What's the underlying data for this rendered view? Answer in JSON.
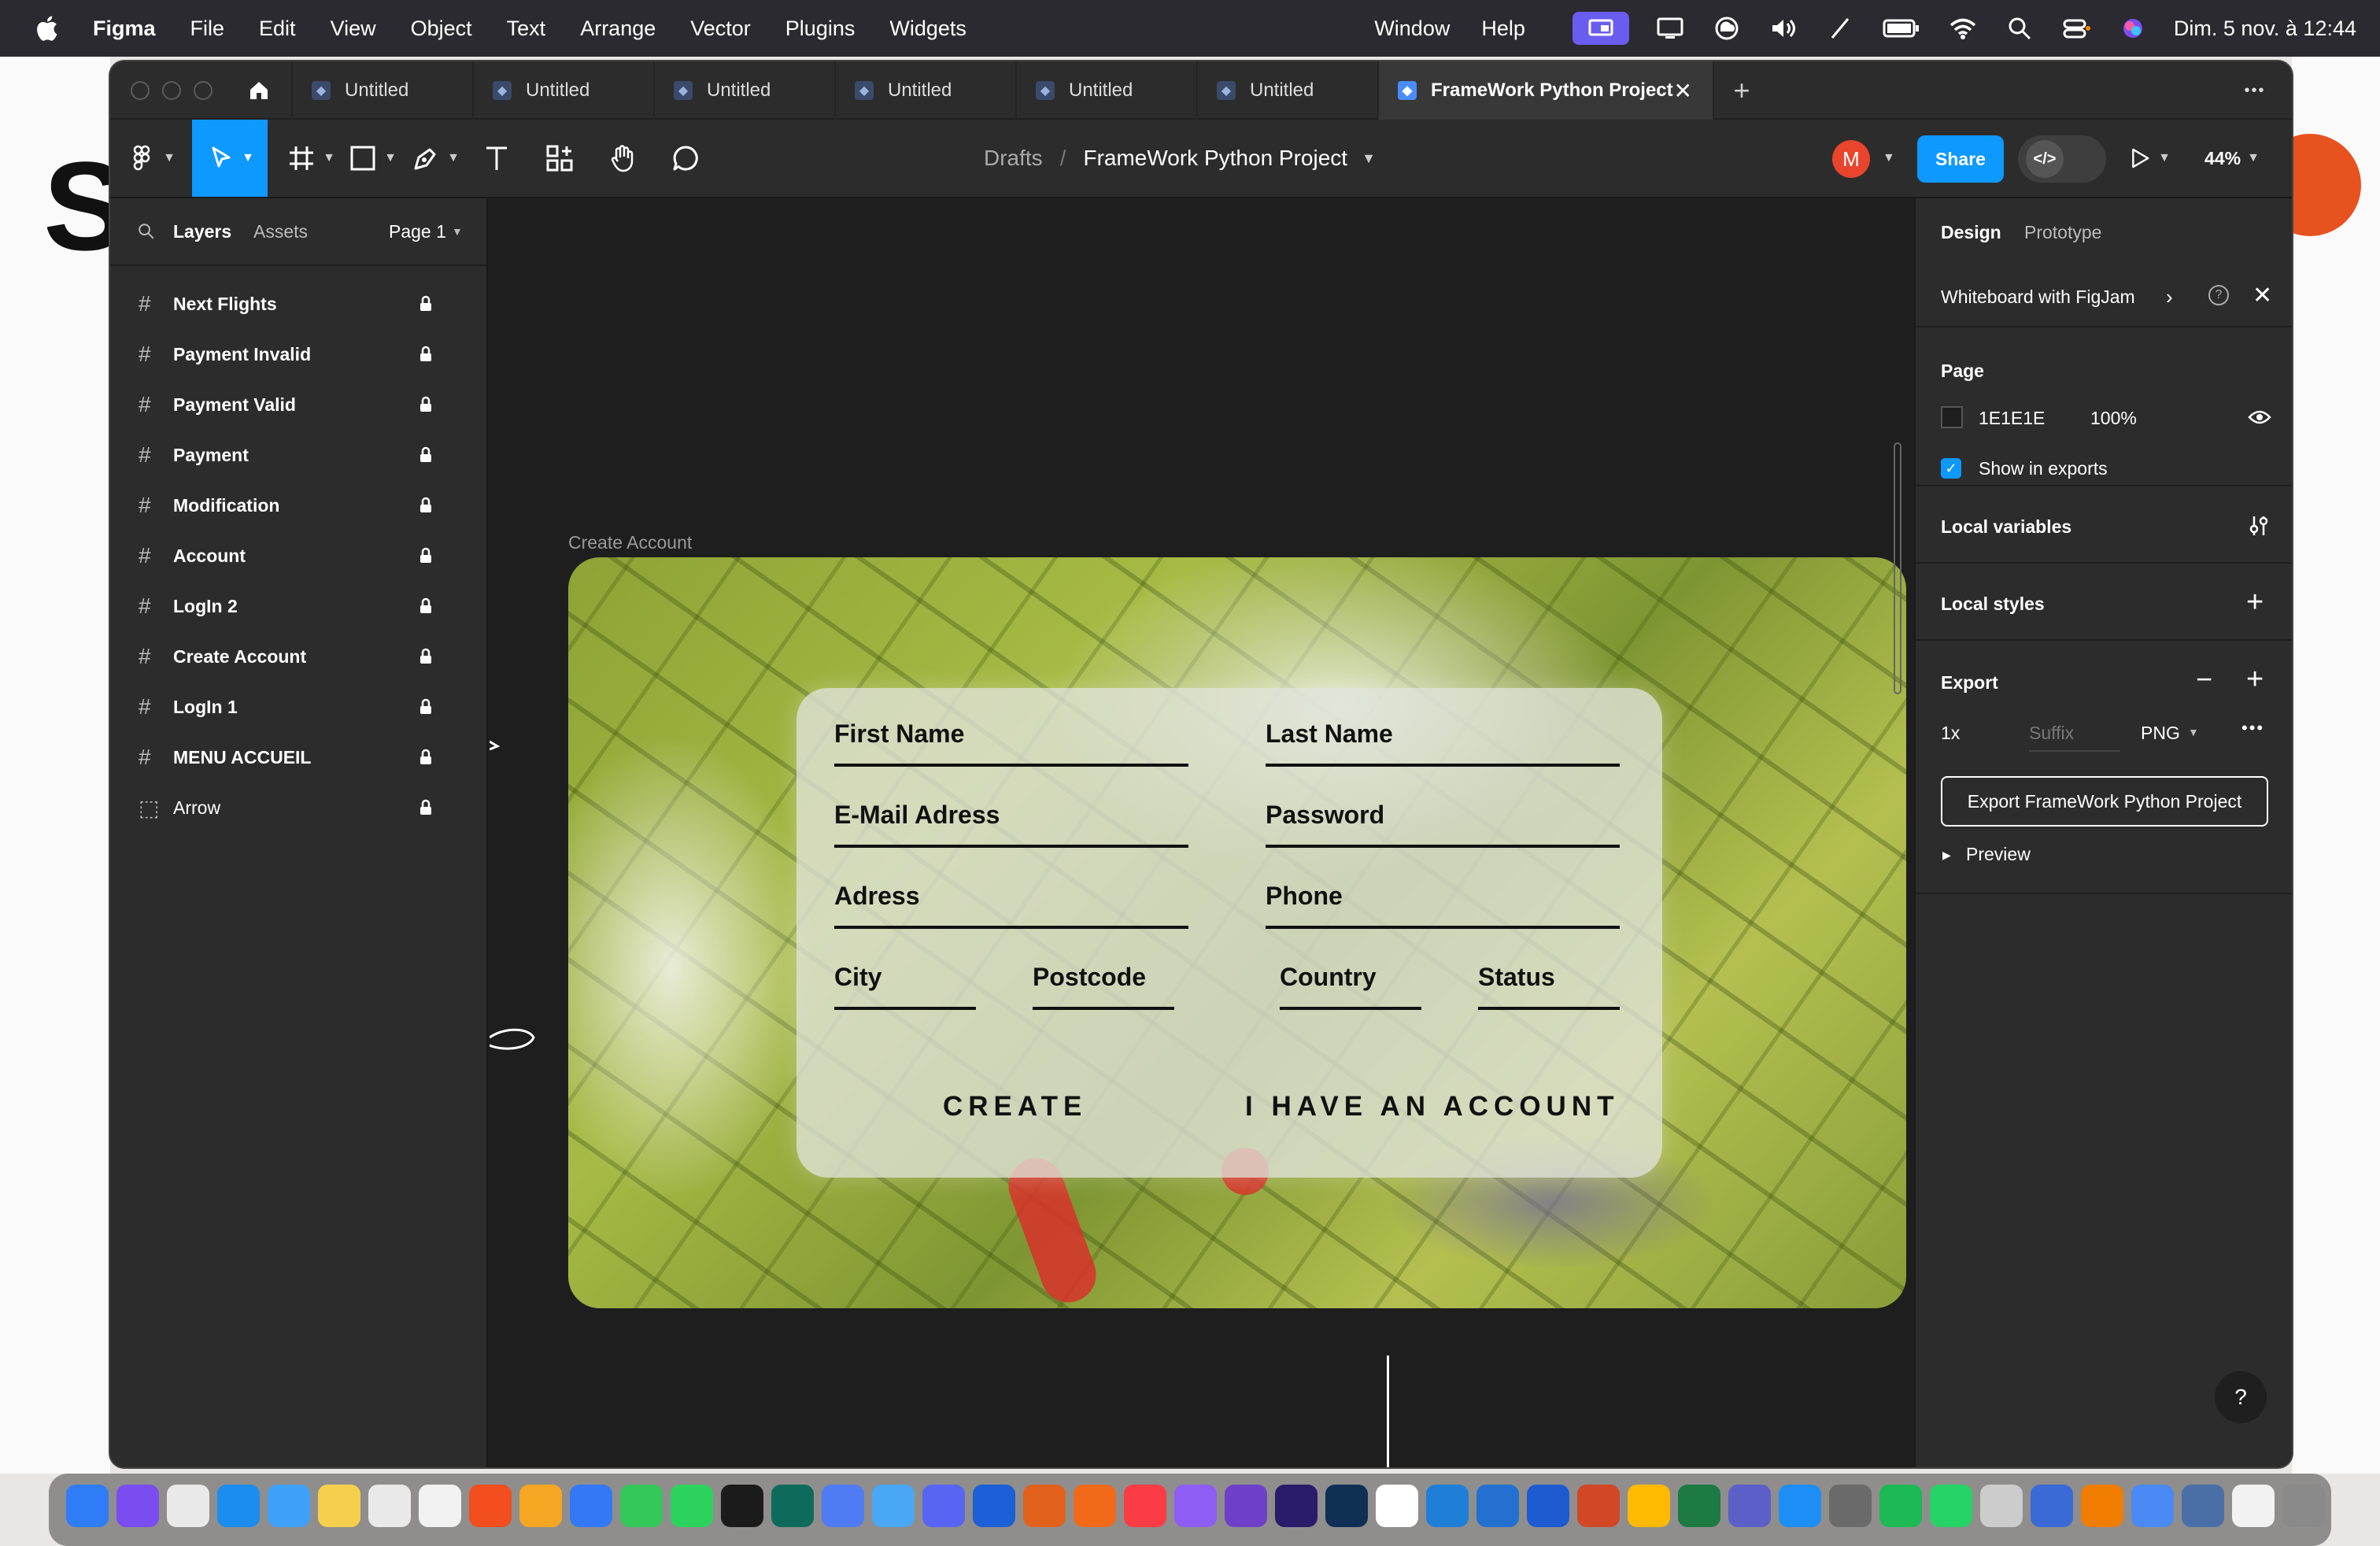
{
  "menubar": {
    "app_name": "Figma",
    "menus": [
      "File",
      "Edit",
      "View",
      "Object",
      "Text",
      "Arrange",
      "Vector",
      "Plugins",
      "Widgets"
    ],
    "right_menus": [
      "Window",
      "Help"
    ],
    "datetime": "Dim. 5 nov. à 12:44"
  },
  "tabs": {
    "items": [
      {
        "label": "Untitled"
      },
      {
        "label": "Untitled"
      },
      {
        "label": "Untitled"
      },
      {
        "label": "Untitled"
      },
      {
        "label": "Untitled"
      },
      {
        "label": "Untitled"
      }
    ],
    "active_label": "FrameWork Python Project",
    "close_glyph": "✕",
    "add_glyph": "+",
    "more_glyph": "•••"
  },
  "toolbar": {
    "breadcrumb_parent": "Drafts",
    "breadcrumb_sep": "/",
    "file_name": "FrameWork Python Project",
    "avatar_letter": "M",
    "share_label": "Share",
    "zoom": "44%"
  },
  "left_panel": {
    "tab_layers": "Layers",
    "tab_assets": "Assets",
    "page_selector": "Page 1",
    "layers": [
      {
        "name": "Next Flights",
        "type": "frame"
      },
      {
        "name": "Payment Invalid",
        "type": "frame"
      },
      {
        "name": "Payment Valid",
        "type": "frame"
      },
      {
        "name": "Payment",
        "type": "frame"
      },
      {
        "name": "Modification",
        "type": "frame"
      },
      {
        "name": "Account",
        "type": "frame"
      },
      {
        "name": "LogIn 2",
        "type": "frame"
      },
      {
        "name": "Create Account",
        "type": "frame"
      },
      {
        "name": "LogIn 1",
        "type": "frame"
      },
      {
        "name": "MENU ACCUEIL",
        "type": "frame"
      },
      {
        "name": "Arrow",
        "type": "group"
      }
    ]
  },
  "canvas": {
    "frame_label": "Create Account",
    "form": {
      "first_name": "First Name",
      "last_name": "Last Name",
      "email": "E-Mail Adress",
      "password": "Password",
      "address": "Adress",
      "phone": "Phone",
      "city": "City",
      "postcode": "Postcode",
      "country": "Country",
      "status": "Status",
      "create": "CREATE",
      "have_account": "I HAVE AN ACCOUNT"
    }
  },
  "right_panel": {
    "tab_design": "Design",
    "tab_prototype": "Prototype",
    "banner": "Whiteboard with FigJam",
    "page_title": "Page",
    "page_color": "1E1E1E",
    "page_color_hex": "#1E1E1E",
    "page_opacity": "100%",
    "show_in_exports": "Show in exports",
    "local_variables": "Local variables",
    "local_styles": "Local styles",
    "export_title": "Export",
    "export_scale": "1x",
    "export_suffix_placeholder": "Suffix",
    "export_format": "PNG",
    "export_button": "Export FrameWork Python Project",
    "preview": "Preview",
    "help_glyph": "?"
  },
  "colors": {
    "accent_blue": "#0d99ff",
    "avatar_red": "#e8452c",
    "canvas_bg": "#1E1E1E"
  }
}
